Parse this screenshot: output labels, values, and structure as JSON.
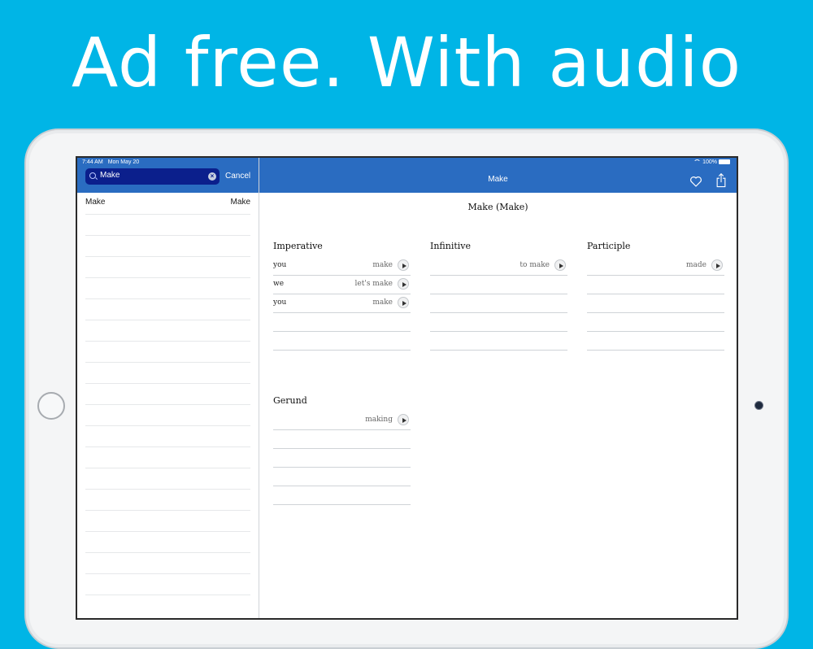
{
  "headline": "Ad free. With audio",
  "status": {
    "time": "7:44 AM",
    "date": "Mon May 20",
    "battery": "100%"
  },
  "search": {
    "value": "Make",
    "cancel_label": "Cancel"
  },
  "results": [
    {
      "word": "Make",
      "translation": "Make"
    }
  ],
  "detail": {
    "nav_title": "Make",
    "word_title": "Make (Make)",
    "sections": {
      "imperative": {
        "title": "Imperative",
        "rows": [
          {
            "pronoun": "you",
            "form": "make"
          },
          {
            "pronoun": "we",
            "form": "let's make"
          },
          {
            "pronoun": "you",
            "form": "make"
          }
        ]
      },
      "infinitive": {
        "title": "Infinitive",
        "rows": [
          {
            "pronoun": "",
            "form": "to make"
          }
        ]
      },
      "participle": {
        "title": "Participle",
        "rows": [
          {
            "pronoun": "",
            "form": "made"
          }
        ]
      },
      "gerund": {
        "title": "Gerund",
        "rows": [
          {
            "pronoun": "",
            "form": "making"
          }
        ]
      }
    }
  },
  "icons": {
    "search": "search-icon",
    "clear": "clear-icon",
    "heart": "heart-icon",
    "share": "share-icon",
    "play": "play-icon",
    "wifi": "wifi-icon",
    "battery": "battery-icon"
  },
  "colors": {
    "background": "#00b5e6",
    "nav_bar": "#2a6cc1",
    "search_field": "#0b1f8c",
    "text": "#111111"
  }
}
